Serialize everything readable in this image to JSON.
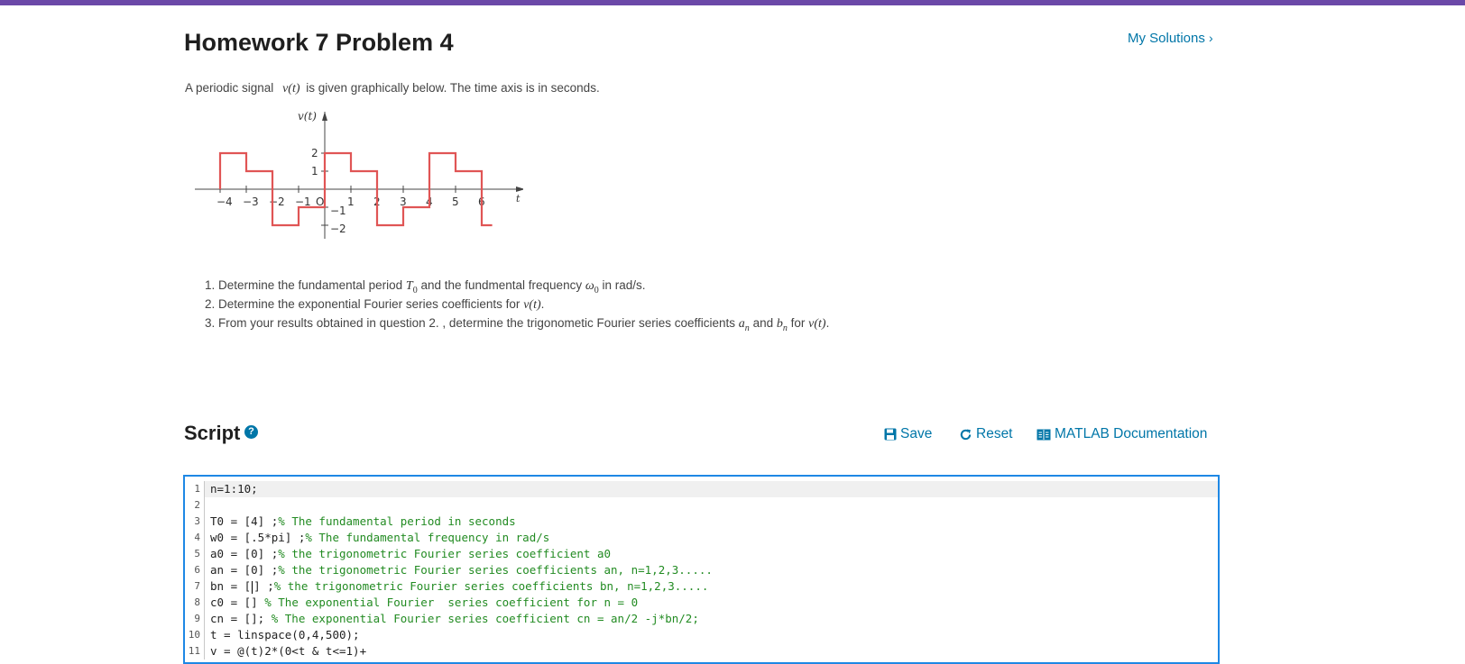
{
  "colors": {
    "top_bar": "#6b48a8",
    "link": "#0076a8",
    "editor_border": "#1e88e5",
    "comment": "#228b22",
    "signal": "#e05555"
  },
  "page": {
    "title": "Homework 7 Problem 4",
    "my_solutions": "My Solutions",
    "my_solutions_icon": "chevron-right-icon"
  },
  "problem": {
    "intro_before": "A periodic signal",
    "intro_signal": "v(t)",
    "intro_after": "is given graphically below. The time axis is in seconds.",
    "questions": [
      {
        "a": "Determine the fundamental period",
        "m1": "T",
        "m1sub": "0",
        "b": "and the fundmental frequency",
        "m2": "ω",
        "m2sub": "0",
        "c": "in rad/s."
      },
      {
        "a": "Determine the exponential Fourier series coefficients for",
        "m1": "v(t)",
        "b": "."
      },
      {
        "a": "From your results obtained in question 2. , determine the trigonometic Fourier series coefficients",
        "m1": "a",
        "m1sub": "n",
        "b": "and",
        "m2": "b",
        "m2sub": "n",
        "c": "for",
        "m3": "v(t)",
        "d": "."
      }
    ]
  },
  "chart_data": {
    "type": "line",
    "ylabel": "v(t)",
    "xlabel": "t",
    "x_ticks": [
      "−4",
      "−3",
      "−2",
      "−1",
      "O",
      "1",
      "2",
      "3",
      "4",
      "5",
      "6"
    ],
    "y_ticks": [
      "2",
      "1",
      "−1",
      "−2"
    ],
    "series": [
      {
        "x": [
          -4,
          -4,
          -3,
          -3,
          -2,
          -2,
          -1,
          -1,
          0,
          0,
          1,
          1,
          2,
          2,
          3,
          3,
          4,
          4,
          5,
          5,
          6,
          6,
          6.4
        ],
        "y": [
          0,
          2,
          2,
          1,
          1,
          -2,
          -2,
          -1,
          -1,
          2,
          2,
          1,
          1,
          -2,
          -2,
          -1,
          -1,
          2,
          2,
          1,
          1,
          -2,
          -2
        ]
      }
    ]
  },
  "script": {
    "title": "Script",
    "help_icon": "question-circle-icon",
    "save": "Save",
    "save_icon": "floppy-disk-icon",
    "reset": "Reset",
    "reset_icon": "refresh-icon",
    "docs": "MATLAB Documentation",
    "docs_icon": "book-icon",
    "lines": [
      {
        "num": "1",
        "code": "n=1:10;",
        "comment": ""
      },
      {
        "num": "2",
        "code": "",
        "comment": ""
      },
      {
        "num": "3",
        "code": "T0 = [4] ;",
        "comment": "% The fundamental period in seconds"
      },
      {
        "num": "4",
        "code": "w0 = [.5*pi] ;",
        "comment": "% The fundamental frequency in rad/s"
      },
      {
        "num": "5",
        "code": "a0 = [0] ;",
        "comment": "% the trigonometric Fourier series coefficient a0"
      },
      {
        "num": "6",
        "code": "an = [0] ;",
        "comment": "% the trigonometric Fourier series coefficients an, n=1,2,3....."
      },
      {
        "num": "7",
        "code": "bn = [",
        "code_after": "] ;",
        "comment": "% the trigonometric Fourier series coefficients bn, n=1,2,3....."
      },
      {
        "num": "8",
        "code": "c0 = [] ",
        "comment": "% The exponential Fourier  series coefficient for n = 0"
      },
      {
        "num": "9",
        "code": "cn = []; ",
        "comment": "% The exponential Fourier series coefficient cn = an/2 -j*bn/2;"
      },
      {
        "num": "10",
        "code": "t = linspace(0,4,500);",
        "comment": ""
      },
      {
        "num": "11",
        "code": "v = @(t)2*(0<t & t<=1)+",
        "comment": ""
      }
    ]
  }
}
